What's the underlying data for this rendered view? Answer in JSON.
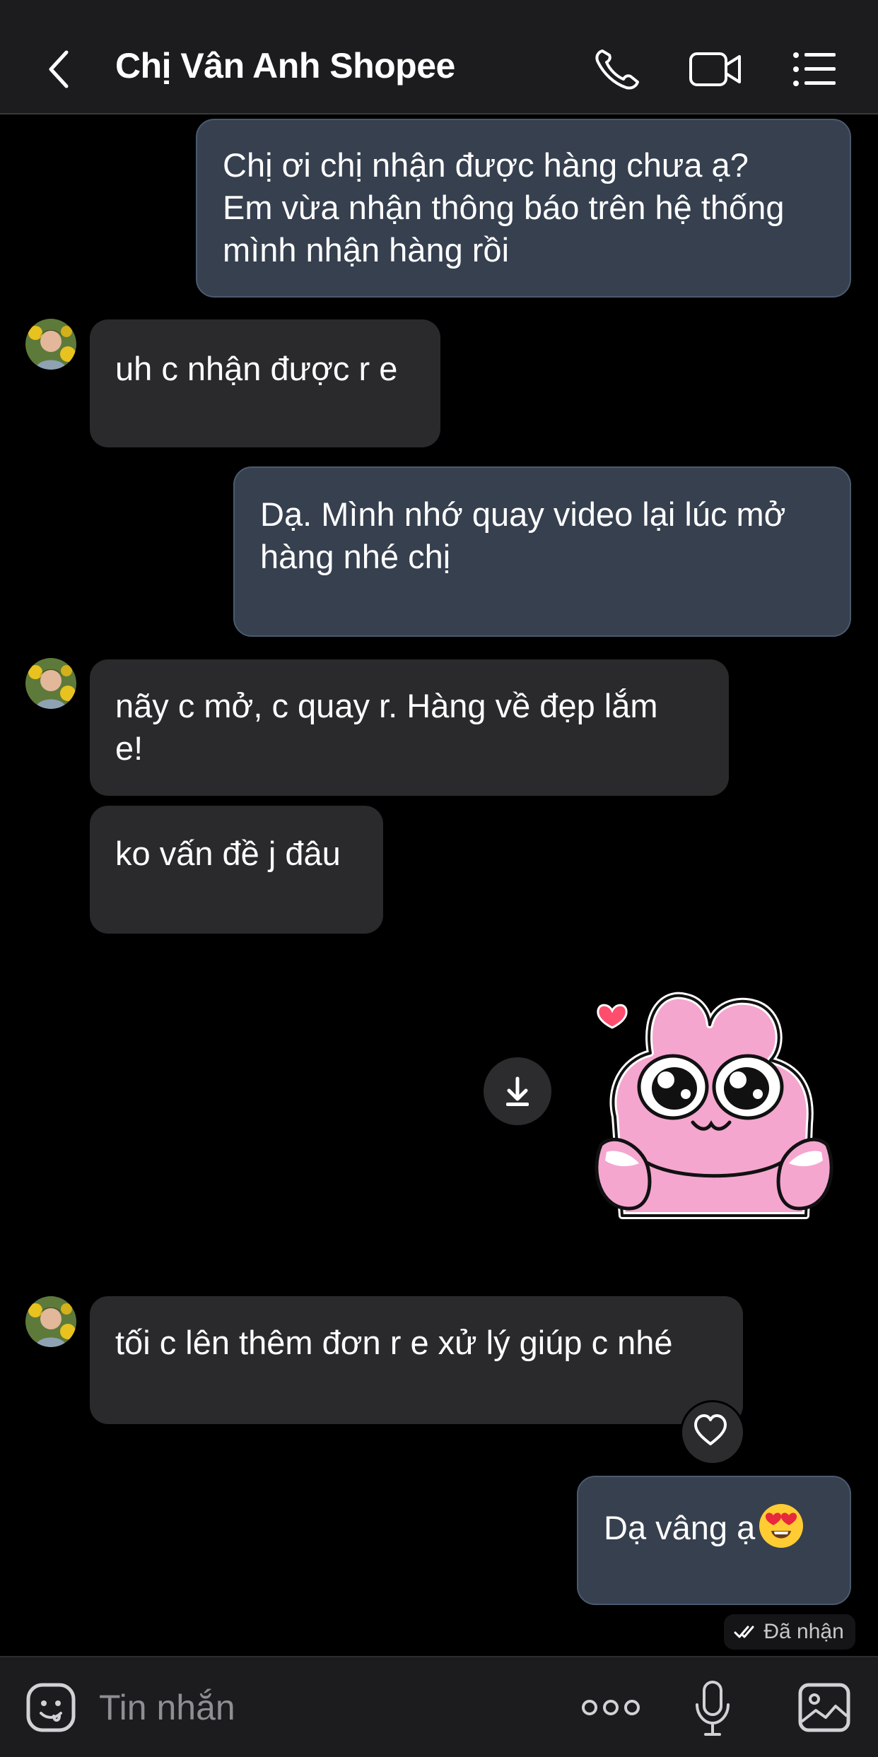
{
  "header": {
    "title": "Chị Vân Anh Shopee",
    "icons": [
      "back-chevron-icon",
      "phone-icon",
      "video-camera-icon",
      "list-menu-icon"
    ]
  },
  "messages": [
    {
      "side": "out",
      "text": "Chị ơi chị nhận được hàng chưa ạ?\nEm vừa nhận thông báo trên hệ thống\nmình nhận hàng rồi"
    },
    {
      "side": "in",
      "text": "uh c nhận được r e"
    },
    {
      "side": "out",
      "text": "Dạ. Mình nhớ quay video lại lúc mở\nhàng nhé chị"
    },
    {
      "side": "in",
      "text": "nãy c mở, c quay r. Hàng về đẹp lắm\ne!"
    },
    {
      "side": "in",
      "text": "ko vấn đề j đâu"
    },
    {
      "side": "out",
      "type": "sticker",
      "sticker": "pink-bunny-blushing-sticker"
    },
    {
      "side": "in",
      "text": "tối c lên thêm đơn r e xử lý giúp c nhé"
    },
    {
      "side": "out",
      "text": "Dạ vâng ạ",
      "emoji": "heart-eyes-emoji"
    }
  ],
  "status": {
    "label": "Đã nhận",
    "icon": "double-check-icon"
  },
  "composer": {
    "placeholder": "Tin nhắn",
    "icons": [
      "sticker-smile-icon",
      "more-dots-icon",
      "microphone-icon",
      "image-gallery-icon"
    ]
  },
  "colors": {
    "background": "#000000",
    "header": "#1c1c1e",
    "outgoing_bubble": "#36404f",
    "incoming_bubble": "#2a2a2c",
    "sticker_pink": "#f4a6cf"
  }
}
